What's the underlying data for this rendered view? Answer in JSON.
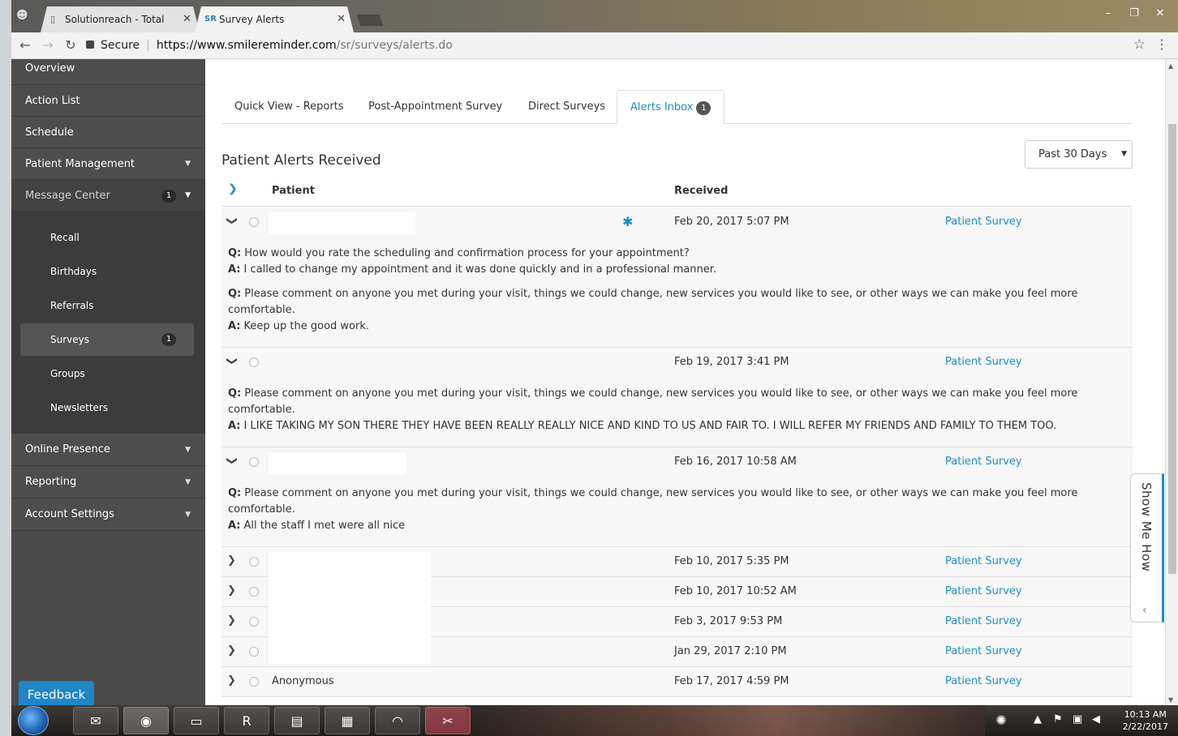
{
  "browser": {
    "tabs": [
      {
        "title": "Solutionreach - Total Pat",
        "close": "✕"
      },
      {
        "title": "Survey Alerts",
        "favicon": "SR",
        "close": "✕"
      }
    ],
    "secure_label": "Secure",
    "url_host": "https://www.smilereminder.com",
    "url_path": "/sr/surveys/alerts.do"
  },
  "sidebar": {
    "items_top": [
      {
        "label": "Overview"
      },
      {
        "label": "Action List"
      },
      {
        "label": "Schedule"
      },
      {
        "label": "Patient Management"
      },
      {
        "label": "Message Center",
        "badge": "1"
      }
    ],
    "submenu": [
      {
        "label": "Recall"
      },
      {
        "label": "Birthdays"
      },
      {
        "label": "Referrals"
      },
      {
        "label": "Surveys",
        "badge": "1"
      },
      {
        "label": "Groups"
      },
      {
        "label": "Newsletters"
      }
    ],
    "items_bottom": [
      {
        "label": "Online Presence"
      },
      {
        "label": "Reporting"
      },
      {
        "label": "Account Settings"
      }
    ]
  },
  "feedback_label": "Feedback",
  "page_tabs": [
    {
      "label": "Quick View - Reports"
    },
    {
      "label": "Post-Appointment Survey"
    },
    {
      "label": "Direct Surveys"
    },
    {
      "label": "Alerts Inbox",
      "badge": "1"
    }
  ],
  "section_title": "Patient Alerts Received",
  "range_select": {
    "value": "Past 30 Days"
  },
  "columns": {
    "patient": "Patient",
    "received": "Received"
  },
  "qa_prefix": {
    "q": "Q:",
    "a": "A:"
  },
  "alerts": [
    {
      "received": "Feb 20, 2017 5:07 PM",
      "type": "Patient Survey",
      "qa": [
        {
          "q": "How would you rate the scheduling and confirmation process for your appointment?",
          "a": "I called to change my appointment and it was done quickly and in a professional manner."
        },
        {
          "q": "Please comment on anyone you met during your visit, things we could change, new services you would like to see, or other ways we can make you feel more comfortable.",
          "a": "Keep up the good work."
        }
      ]
    },
    {
      "received": "Feb 19, 2017 3:41 PM",
      "type": "Patient Survey",
      "qa": [
        {
          "q": "Please comment on anyone you met during your visit, things we could change, new services you would like to see, or other ways we can make you feel more comfortable.",
          "a": "I LIKE TAKING MY SON THERE THEY HAVE BEEN REALLY REALLY NICE AND KIND TO US AND FAIR TO. I WILL REFER MY FRIENDS AND FAMILY TO THEM TOO."
        }
      ]
    },
    {
      "received": "Feb 16, 2017 10:58 AM",
      "type": "Patient Survey",
      "qa": [
        {
          "q": "Please comment on anyone you met during your visit, things we could change, new services you would like to see, or other ways we can make you feel more comfortable.",
          "a": "All the staff I met were all nice"
        }
      ]
    }
  ],
  "collapsed_alerts": [
    {
      "patient": "",
      "received": "Feb 10, 2017 5:35 PM",
      "type": "Patient Survey"
    },
    {
      "patient": "",
      "received": "Feb 10, 2017 10:52 AM",
      "type": "Patient Survey"
    },
    {
      "patient": "",
      "received": "Feb 3, 2017 9:53 PM",
      "type": "Patient Survey"
    },
    {
      "patient": "",
      "received": "Jan 29, 2017 2:10 PM",
      "type": "Patient Survey"
    },
    {
      "patient": "Anonymous",
      "received": "Feb 17, 2017 4:59 PM",
      "type": "Patient Survey"
    }
  ],
  "show_me_how": "Show Me How",
  "clock": {
    "time": "10:13 AM",
    "date": "2/22/2017"
  },
  "colors": {
    "accent": "#1e8ec3",
    "sidebar": "#4a4a4a",
    "feedback": "#1f86c7"
  },
  "icons": {
    "back": "back-arrow-icon",
    "forward": "forward-arrow-icon",
    "reload": "reload-icon",
    "star": "bookmark-star-icon",
    "menu": "kebab-menu-icon",
    "lock": "lock-icon"
  }
}
